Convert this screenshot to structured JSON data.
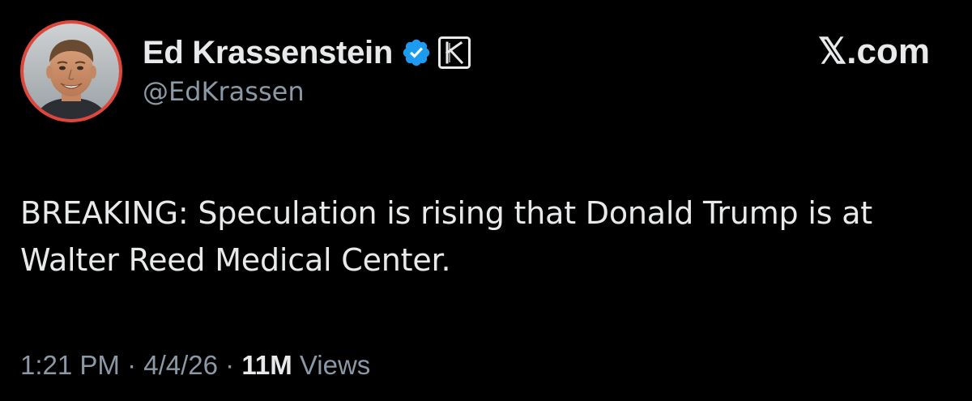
{
  "author": {
    "display_name": "Ed Krassenstein",
    "handle": "@EdKrassen",
    "verified_icon": "verified-badge-icon",
    "affiliate_icon": "k-affiliate-icon",
    "verified_color": "#1d9bf0",
    "avatar_ring_color": "#e2453a"
  },
  "site": {
    "brand": "𝕏.com"
  },
  "tweet": {
    "text": "BREAKING: Speculation is rising that Donald Trump is at Walter Reed Medical Center."
  },
  "meta": {
    "time": "1:21 PM",
    "separator1": " · ",
    "date": "4/4/26",
    "separator2": " · ",
    "views_count": "11M",
    "views_label": " Views"
  },
  "colors": {
    "background": "#000000",
    "primary_text": "#e7e9ea",
    "secondary_text": "#8b98a5"
  }
}
